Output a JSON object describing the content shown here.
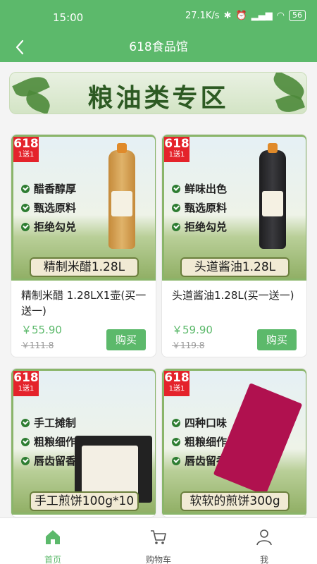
{
  "status_bar": {
    "time": "15:00",
    "network": "27.1K/s",
    "battery": "56"
  },
  "header": {
    "title": "618食品馆"
  },
  "banner": {
    "text": "粮油类专区"
  },
  "products": [
    {
      "badge_top": "618",
      "badge_bottom": "1送1",
      "features": [
        "醋香醇厚",
        "甄选原料",
        "拒绝勾兑"
      ],
      "image_label": "精制米醋1.28L",
      "name": "精制米醋 1.28LX1壶(买一送一)",
      "price": "￥55.90",
      "original_price": "￥111.8",
      "buy_label": "购买"
    },
    {
      "badge_top": "618",
      "badge_bottom": "1送1",
      "features": [
        "鲜味出色",
        "甄选原料",
        "拒绝勾兑"
      ],
      "image_label": "头道酱油1.28L",
      "name": "头道酱油1.28L(买一送一)",
      "price": "￥59.90",
      "original_price": "￥119.8",
      "buy_label": "购买"
    },
    {
      "badge_top": "618",
      "badge_bottom": "1送1",
      "features": [
        "手工摊制",
        "粗粮细作",
        "唇齿留香"
      ],
      "image_label": "手工煎饼100g*10"
    },
    {
      "badge_top": "618",
      "badge_bottom": "1送1",
      "features": [
        "四种口味",
        "粗粮细作",
        "唇齿留香"
      ],
      "image_label": "软软的煎饼300g"
    }
  ],
  "tabbar": [
    {
      "label": "首页",
      "icon": "home-icon",
      "active": true
    },
    {
      "label": "购物车",
      "icon": "cart-icon",
      "active": false
    },
    {
      "label": "我",
      "icon": "user-icon",
      "active": false
    }
  ],
  "colors": {
    "brand": "#5cb96b",
    "badge": "#e4232b"
  }
}
